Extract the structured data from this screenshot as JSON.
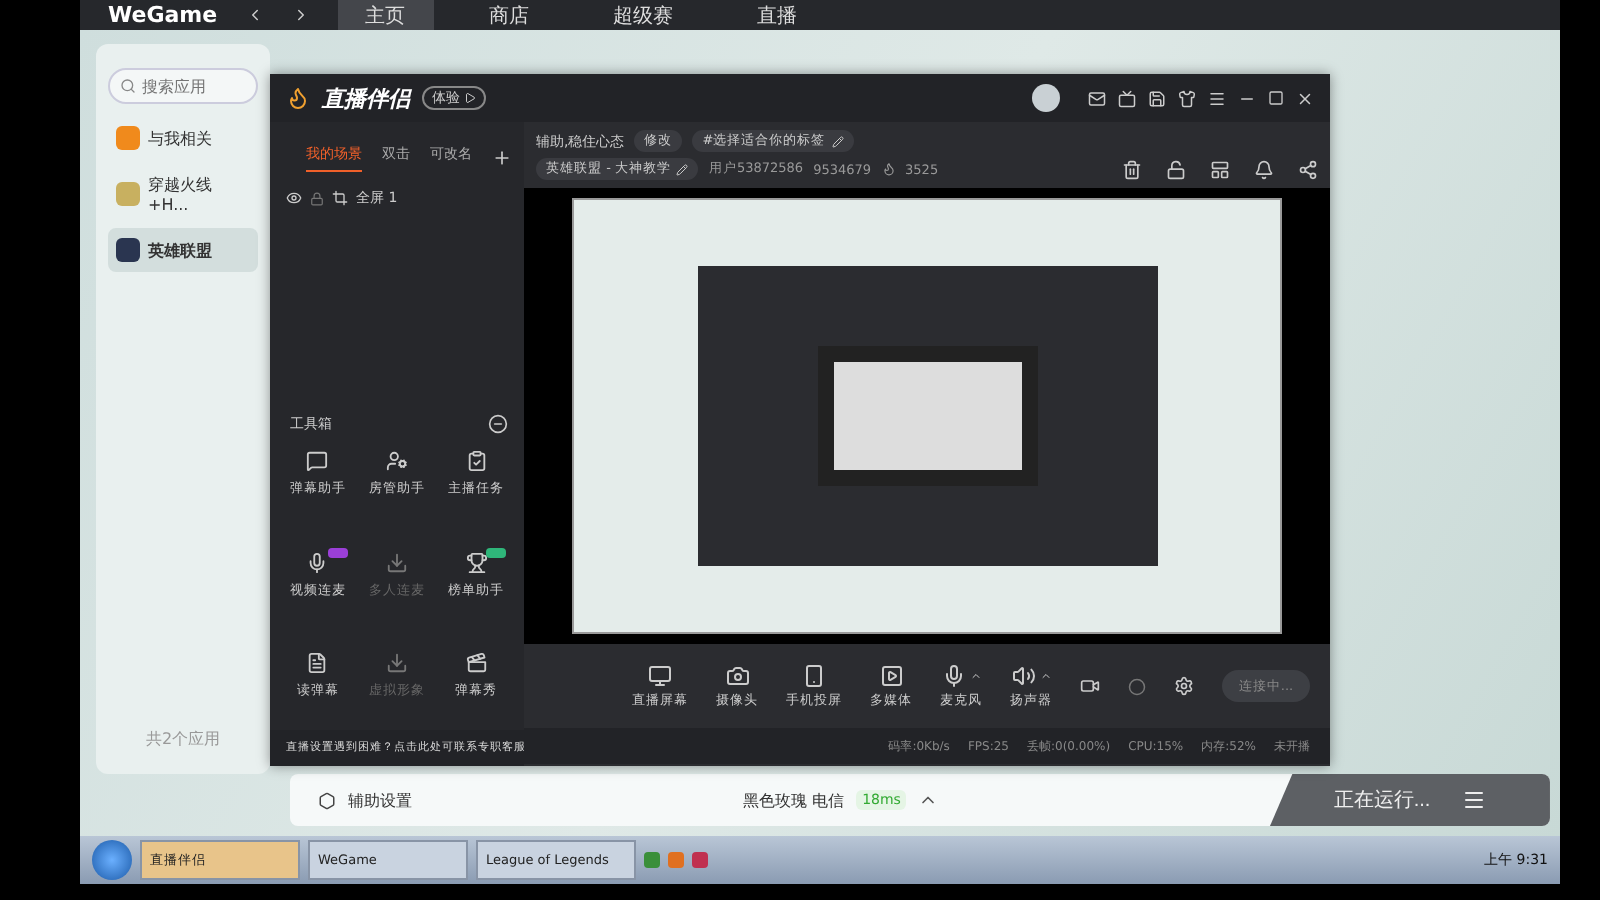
{
  "wegame": {
    "logo": "WeGame",
    "nav": [
      {
        "label": "主页",
        "selected": true
      },
      {
        "label": "商店",
        "selected": false
      },
      {
        "label": "超级赛",
        "selected": false
      },
      {
        "label": "直播",
        "selected": false
      }
    ],
    "sidebar": {
      "search_placeholder": "搜索应用",
      "items": [
        {
          "label": "与我相关",
          "selected": false
        },
        {
          "label": "穿越火线+H...",
          "selected": false
        },
        {
          "label": "英雄联盟",
          "selected": true
        }
      ],
      "footer": "共2个应用"
    },
    "bottom_bar": {
      "settings": "辅助设置",
      "server": "黑色玫瑰 电信",
      "ping": "18ms",
      "status": "正在运行..."
    }
  },
  "streamer": {
    "logo": "直播伴侣",
    "badge": "体验",
    "scene_tabs": [
      {
        "label": "我的场景",
        "selected": true
      },
      {
        "label": "双击",
        "selected": false
      },
      {
        "label": "可改名",
        "selected": false
      }
    ],
    "source": {
      "label": "全屏 1",
      "visible": true
    },
    "toolbox_title": "工具箱",
    "tools": [
      {
        "label": "弹幕助手",
        "disabled": false
      },
      {
        "label": "房管助手",
        "disabled": false
      },
      {
        "label": "主播任务",
        "disabled": false
      },
      {
        "label": "视频连麦",
        "disabled": false,
        "color": "#9b3fd8"
      },
      {
        "label": "多人连麦",
        "disabled": true
      },
      {
        "label": "榜单助手",
        "disabled": false,
        "color": "#2fb67a"
      },
      {
        "label": "读弹幕",
        "disabled": false
      },
      {
        "label": "虚拟形象",
        "disabled": true
      },
      {
        "label": "弹幕秀",
        "disabled": false
      }
    ],
    "notice": "直播设置遇到困难？点击此处可联系专职客服",
    "title": "辅助,稳住心态",
    "edit": "修改",
    "tag": "#选择适合你的标签",
    "category": "英雄联盟 - 大神教学",
    "user_id": "用户53872586",
    "room_id": "9534679",
    "heat": "3525",
    "controls": [
      {
        "label": "直播屏幕",
        "kind": "plain"
      },
      {
        "label": "摄像头",
        "kind": "plain"
      },
      {
        "label": "手机投屏",
        "kind": "plain"
      },
      {
        "label": "多媒体",
        "kind": "plain"
      },
      {
        "label": "麦克风",
        "kind": "dropdown"
      },
      {
        "label": "扬声器",
        "kind": "dropdown"
      }
    ],
    "start_button": "连接中...",
    "stats": [
      "码率:0Kb/s",
      "FPS:25",
      "丢帧:0(0.00%)",
      "CPU:15%",
      "内存:52%",
      "未开播"
    ]
  },
  "taskbar": {
    "tasks": [
      {
        "label": "直播伴侣",
        "selected": true
      },
      {
        "label": "WeGame",
        "selected": false
      },
      {
        "label": "League of Legends",
        "selected": false
      }
    ],
    "clock": "上午 9:31"
  }
}
